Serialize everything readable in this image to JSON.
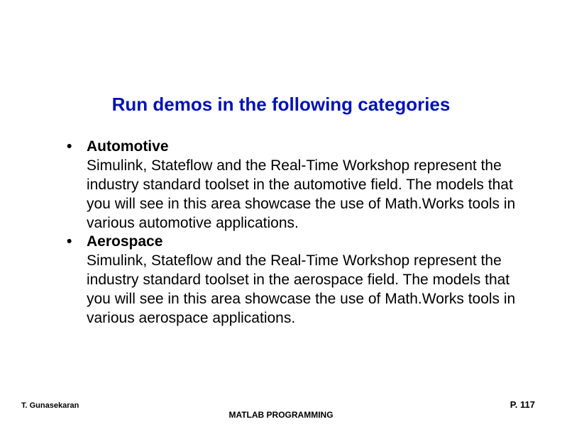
{
  "title": "Run demos in the following categories",
  "bullets": [
    {
      "label": "Automotive",
      "desc": "Simulink, Stateflow and the Real-Time Workshop represent the industry standard toolset in the automotive field. The models that you will see in this area showcase the use of Math.Works tools in various automotive applications."
    },
    {
      "label": "Aerospace",
      "desc": "Simulink, Stateflow and the Real-Time Workshop represent the industry standard toolset in the aerospace field. The models that you will see in this area showcase the use of Math.Works tools in various aerospace applications."
    }
  ],
  "author": "T. Gunasekaran",
  "footer_center": "MATLAB PROGRAMMING",
  "page_number": "P. 117"
}
